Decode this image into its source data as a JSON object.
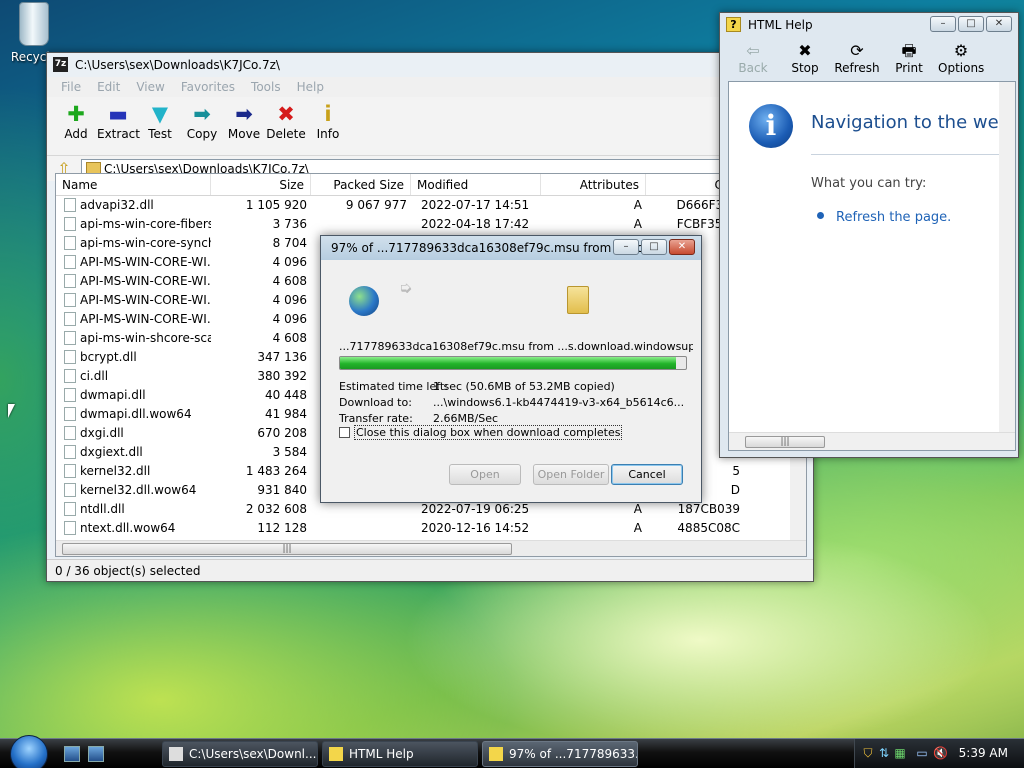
{
  "desktop": {
    "recycle_label": "Recycle"
  },
  "sevenzip": {
    "title": "C:\\Users\\sex\\Downloads\\K7JCo.7z\\",
    "menu": [
      "File",
      "Edit",
      "View",
      "Favorites",
      "Tools",
      "Help"
    ],
    "toolbar": [
      {
        "icon": "add-icon",
        "label": "Add",
        "glyph": "✚",
        "color": "#1da81d"
      },
      {
        "icon": "extract-icon",
        "label": "Extract",
        "glyph": "▬",
        "color": "#2534b8"
      },
      {
        "icon": "test-icon",
        "label": "Test",
        "glyph": "▼",
        "color": "#22b3c9"
      },
      {
        "icon": "copy-icon",
        "label": "Copy",
        "glyph": "➡",
        "color": "#17909a"
      },
      {
        "icon": "move-icon",
        "label": "Move",
        "glyph": "➡",
        "color": "#1b2a8c"
      },
      {
        "icon": "delete-icon",
        "label": "Delete",
        "glyph": "✖",
        "color": "#d51a1a"
      },
      {
        "icon": "info-icon",
        "label": "Info",
        "glyph": "i",
        "color": "#c8a11a"
      }
    ],
    "address": "C:\\Users\\sex\\Downloads\\K7JCo.7z\\",
    "columns": [
      "Name",
      "Size",
      "Packed Size",
      "Modified",
      "Attributes",
      "CRC"
    ],
    "rows": [
      {
        "name": "advapi32.dll",
        "size": "1 105 920",
        "packed": "9 067 977",
        "modified": "2022-07-17 14:51",
        "attr": "A",
        "crc": "D666F3DE"
      },
      {
        "name": "api-ms-win-core-fibers...",
        "size": "3 736",
        "packed": "",
        "modified": "2022-04-18 17:42",
        "attr": "A",
        "crc": "FCBF35CD"
      },
      {
        "name": "api-ms-win-core-synch...",
        "size": "8 704",
        "packed": "",
        "modified": "",
        "attr": "",
        "crc": "2"
      },
      {
        "name": "API-MS-WIN-CORE-WI...",
        "size": "4 096",
        "packed": "",
        "modified": "",
        "attr": "",
        "crc": "C"
      },
      {
        "name": "API-MS-WIN-CORE-WI...",
        "size": "4 608",
        "packed": "",
        "modified": "",
        "attr": "",
        "crc": "C"
      },
      {
        "name": "API-MS-WIN-CORE-WI...",
        "size": "4 096",
        "packed": "",
        "modified": "",
        "attr": "",
        "crc": "3"
      },
      {
        "name": "API-MS-WIN-CORE-WI...",
        "size": "4 096",
        "packed": "",
        "modified": "",
        "attr": "",
        "crc": "4"
      },
      {
        "name": "api-ms-win-shcore-scal...",
        "size": "4 608",
        "packed": "",
        "modified": "",
        "attr": "",
        "crc": "4"
      },
      {
        "name": "bcrypt.dll",
        "size": "347 136",
        "packed": "",
        "modified": "",
        "attr": "",
        "crc": "F"
      },
      {
        "name": "ci.dll",
        "size": "380 392",
        "packed": "",
        "modified": "",
        "attr": "",
        "crc": "3"
      },
      {
        "name": "dwmapi.dll",
        "size": "40 448",
        "packed": "",
        "modified": "",
        "attr": "",
        "crc": "9"
      },
      {
        "name": "dwmapi.dll.wow64",
        "size": "41 984",
        "packed": "",
        "modified": "",
        "attr": "",
        "crc": "5"
      },
      {
        "name": "dxgi.dll",
        "size": "670 208",
        "packed": "",
        "modified": "",
        "attr": "",
        "crc": "5"
      },
      {
        "name": "dxgiext.dll",
        "size": "3 584",
        "packed": "",
        "modified": "",
        "attr": "",
        "crc": "5"
      },
      {
        "name": "kernel32.dll",
        "size": "1 483 264",
        "packed": "",
        "modified": "",
        "attr": "",
        "crc": "5"
      },
      {
        "name": "kernel32.dll.wow64",
        "size": "931 840",
        "packed": "",
        "modified": "",
        "attr": "",
        "crc": "D"
      },
      {
        "name": "ntdll.dll",
        "size": "2 032 608",
        "packed": "",
        "modified": "2022-07-19 06:25",
        "attr": "A",
        "crc": "187CB039"
      },
      {
        "name": "ntext.dll.wow64",
        "size": "112 128",
        "packed": "",
        "modified": "2020-12-16 14:52",
        "attr": "A",
        "crc": "4885C08C"
      }
    ],
    "status": "0 / 36 object(s) selected"
  },
  "download": {
    "title": "97% of ...717789633dca16308ef79c.msu from ...s.d...",
    "url_line": "...717789633dca16308ef79c.msu from ...s.download.windowsupdate.c",
    "progress": 0.97,
    "estimated_label": "Estimated time left:",
    "estimated_value": "1 sec (50.6MB of 53.2MB copied)",
    "download_to_label": "Download to:",
    "download_to_value": "...\\windows6.1-kb4474419-v3-x64_b5614c6...",
    "rate_label": "Transfer rate:",
    "rate_value": "2.66MB/Sec",
    "checkbox_label": "Close this dialog box when download completes",
    "checkbox_checked": false,
    "open_label": "Open",
    "open_folder_label": "Open Folder",
    "cancel_label": "Cancel"
  },
  "help": {
    "title": "HTML Help",
    "toolbar": [
      {
        "icon": "back-icon",
        "label": "Back",
        "glyph": "⇦",
        "enabled": false
      },
      {
        "icon": "stop-icon",
        "label": "Stop",
        "glyph": "✖",
        "enabled": true
      },
      {
        "icon": "refresh-icon",
        "label": "Refresh",
        "glyph": "⟳",
        "enabled": true
      },
      {
        "icon": "print-icon",
        "label": "Print",
        "glyph": "🖶",
        "enabled": true
      },
      {
        "icon": "options-icon",
        "label": "Options",
        "glyph": "⚙",
        "enabled": true
      }
    ],
    "heading": "Navigation to the webp",
    "try_text": "What you can try:",
    "refresh_link": "Refresh the page."
  },
  "taskbar": {
    "tasks": [
      {
        "icon": "7zip-icon",
        "label": "C:\\Users\\sex\\Downl..."
      },
      {
        "icon": "help-icon",
        "label": "HTML Help"
      },
      {
        "icon": "download-icon",
        "label": "97% of ...717789633..."
      }
    ],
    "clock": "5:39 AM"
  }
}
